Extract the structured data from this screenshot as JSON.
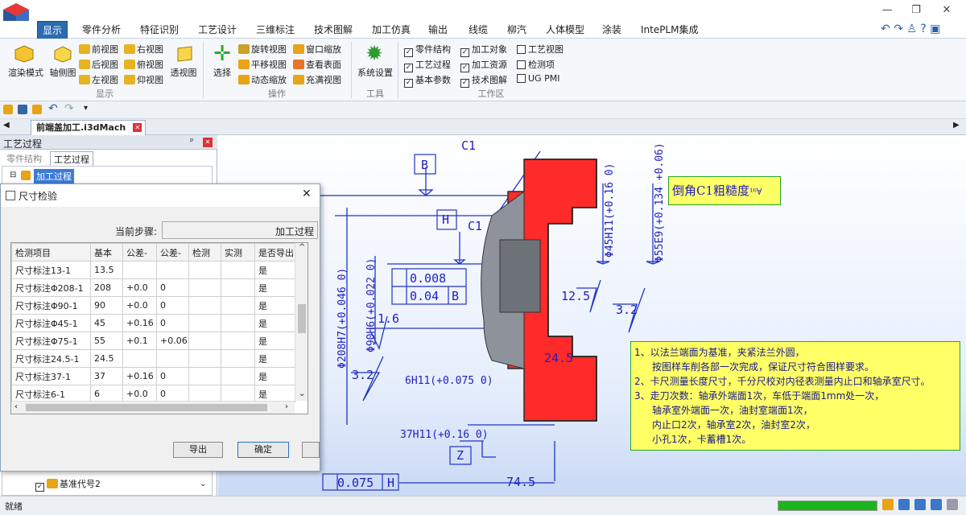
{
  "window": {
    "min_label": "—",
    "restore_label": "❐",
    "close_label": "✕"
  },
  "menu": {
    "items": [
      "显示",
      "零件分析",
      "特征识别",
      "工艺设计",
      "三维标注",
      "技术图解",
      "加工仿真",
      "输出",
      "线缆",
      "柳汽",
      "人体模型",
      "涂装",
      "IntePLM集成"
    ]
  },
  "ribbon": {
    "big": {
      "render": "渲染模式",
      "axis": "轴侧图",
      "select": "选择",
      "syscfg": "系统设置",
      "persp": "透视图"
    },
    "views": [
      "前视图",
      "右视图",
      "后视图",
      "俯视图",
      "左视图",
      "仰视图"
    ],
    "ops": [
      "旋转视图",
      "窗口缩放",
      "平移视图",
      "查看表面",
      "动态缩放",
      "充满视图"
    ],
    "workspace": [
      {
        "label": "零件结构",
        "checked": true
      },
      {
        "label": "加工对象",
        "checked": true
      },
      {
        "label": "工艺视图",
        "checked": false
      },
      {
        "label": "工艺过程",
        "checked": true
      },
      {
        "label": "加工资源",
        "checked": true
      },
      {
        "label": "检测项",
        "checked": false
      },
      {
        "label": "基本参数",
        "checked": true
      },
      {
        "label": "技术图解",
        "checked": true
      },
      {
        "label": "UG PMI",
        "checked": false
      }
    ],
    "groups": {
      "display": "显示",
      "ops": "操作",
      "tools": "工具",
      "workspace": "工作区"
    }
  },
  "tab": {
    "doc": "前端盖加工.i3dMach"
  },
  "left": {
    "title": "工艺过程",
    "pin": "ᵖ",
    "close": "✕",
    "tabs": [
      "零件结构",
      "工艺过程"
    ],
    "root": "加工过程",
    "bottom_item": "基准代号2"
  },
  "dialog": {
    "title": "尺寸检验",
    "close": "✕",
    "step_label": "当前步骤:",
    "step_value": "加工过程",
    "headers": [
      "检测项目",
      "基本",
      "公差-",
      "公差-",
      "检测",
      "实测",
      "是否导出"
    ],
    "rows": [
      [
        "尺寸标注13-1",
        "13.5",
        "",
        "",
        "",
        "",
        "是"
      ],
      [
        "尺寸标注Φ208-1",
        "208",
        "+0.0",
        "0",
        "",
        "",
        "是"
      ],
      [
        "尺寸标注Φ90-1",
        "90",
        "+0.0",
        "0",
        "",
        "",
        "是"
      ],
      [
        "尺寸标注Φ45-1",
        "45",
        "+0.16",
        "0",
        "",
        "",
        "是"
      ],
      [
        "尺寸标注Φ75-1",
        "55",
        "+0.1",
        "+0.06",
        "",
        "",
        "是"
      ],
      [
        "尺寸标注24.5-1",
        "24.5",
        "",
        "",
        "",
        "",
        "是"
      ],
      [
        "尺寸标注37-1",
        "37",
        "+0.16",
        "0",
        "",
        "",
        "是"
      ],
      [
        "尺寸标注6-1",
        "6",
        "+0.0",
        "0",
        "",
        "",
        "是"
      ]
    ],
    "export": "导出",
    "ok": "确定"
  },
  "drawing": {
    "labels": {
      "C1": "C1",
      "B": "B",
      "H": "H",
      "C1b": "C1",
      "flat": "0.008",
      "runout": "0.04",
      "runout_ref": "B",
      "d45": "Φ45H11(+0.16 0)",
      "d55": "Φ55E9(+0.134 +0.06)",
      "d208": "Φ208H7(+0.046 0)",
      "d90": "Φ90H6(+0.022 0)",
      "r16": "1.6",
      "r125": "12.5",
      "r32a": "3.2",
      "r32b": "3.2",
      "d245": "24.5",
      "d6": "6H11(+0.075 0)",
      "d37": "37H11(+0.16 0)",
      "z": "Z",
      "d745": "74.5",
      "pos": "0.075",
      "pos_ref": "H"
    },
    "chamfer_note": "倒角C1粗糙度",
    "chamfer_sym": "¹⁶∀",
    "note_lines": [
      "1、以法兰端面为基准，夹紧法兰外圆，",
      "按图样车削各部一次完成，保证尺寸符合图样要求。",
      "2、卡尺测量长度尺寸，千分尺校对内径表测量内止口和轴承室尺寸。",
      "3、走刀次数：轴承外端面1次，车低于端面1mm处一次，",
      "轴承室外端面一次，油封室端面1次，",
      "内止口2次，轴承室2次，油封室2次，",
      "小孔1次，卡蓄槽1次。"
    ]
  },
  "status": {
    "text": "就绪",
    "progress": 1.0
  }
}
